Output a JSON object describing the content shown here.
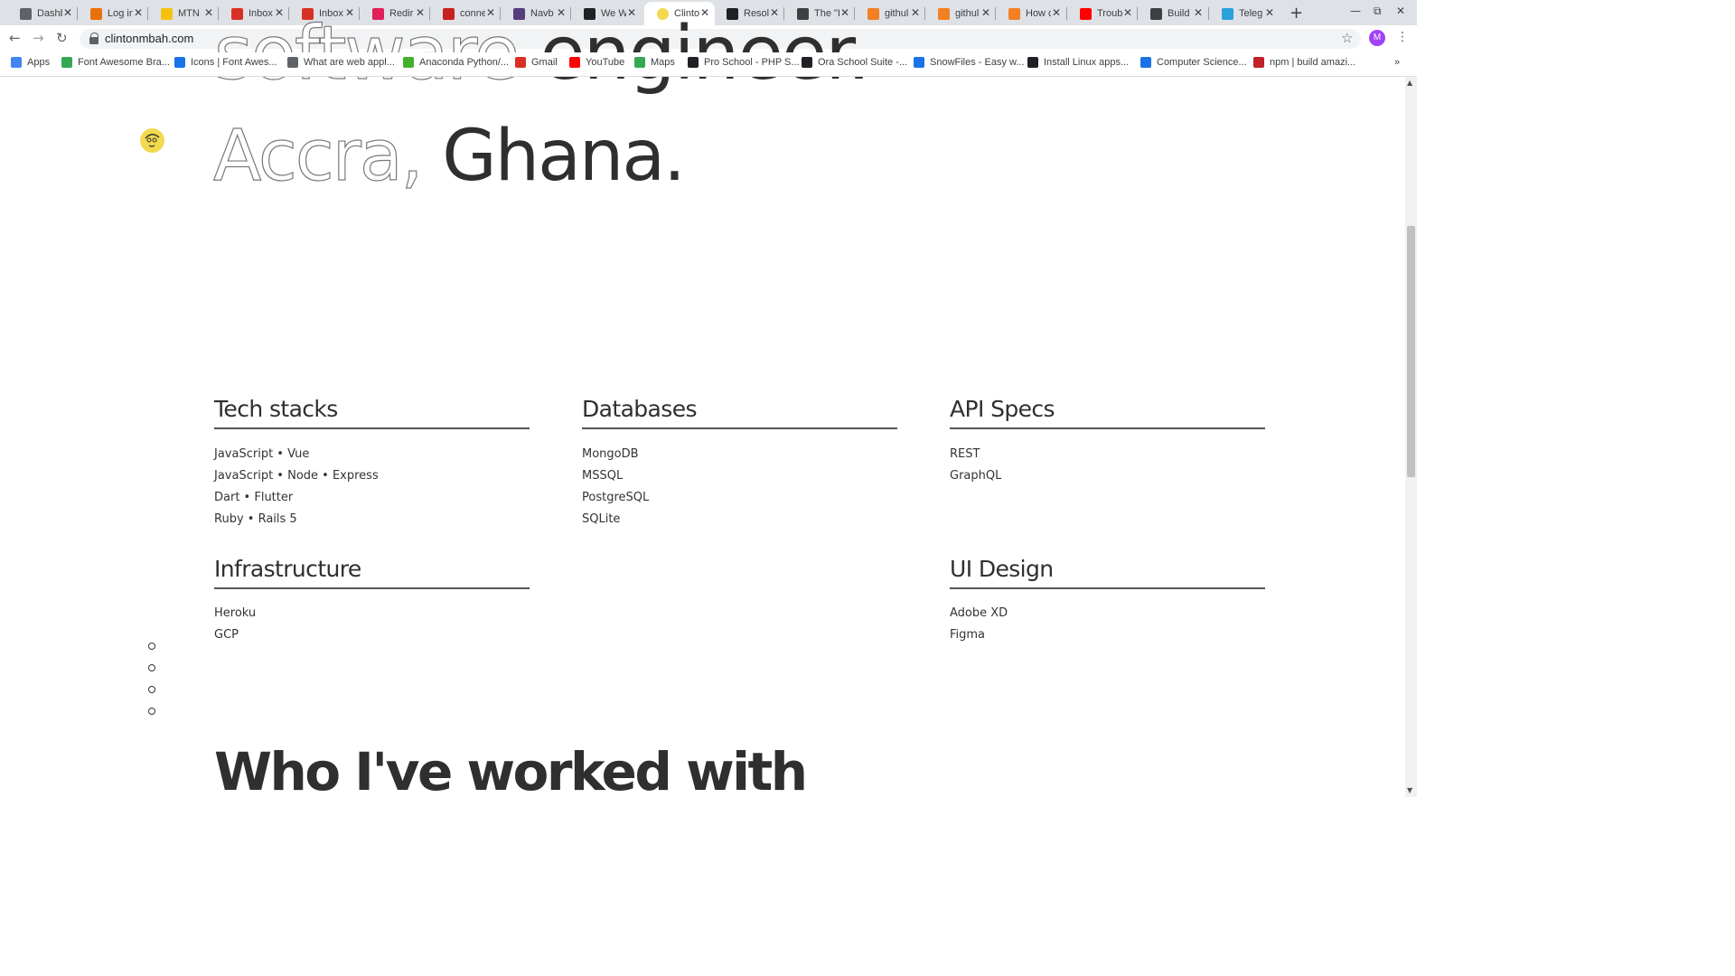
{
  "browser": {
    "tabs": [
      {
        "title": "Dashb",
        "color": "#5f6368"
      },
      {
        "title": "Log in",
        "color": "#e8710a"
      },
      {
        "title": "MTN",
        "color": "#f4c20d"
      },
      {
        "title": "Inbox",
        "color": "#d93025"
      },
      {
        "title": "Inbox",
        "color": "#d93025"
      },
      {
        "title": "Redir",
        "color": "#e01e5a"
      },
      {
        "title": "conne",
        "color": "#c5221f"
      },
      {
        "title": "Navb",
        "color": "#563d7c"
      },
      {
        "title": "We W",
        "color": "#202124"
      },
      {
        "title": "Clinto",
        "color": "#f2d94e"
      },
      {
        "title": "Resol",
        "color": "#202124"
      },
      {
        "title": "The \"I",
        "color": "#3c4043"
      },
      {
        "title": "githul",
        "color": "#f48024"
      },
      {
        "title": "githul",
        "color": "#f48024"
      },
      {
        "title": "How c",
        "color": "#f48024"
      },
      {
        "title": "Troub",
        "color": "#ff0000"
      },
      {
        "title": "Build",
        "color": "#3c4043"
      },
      {
        "title": "Teleg",
        "color": "#2aa1da"
      }
    ],
    "active_tab": 9,
    "url": "clintonmbah.com",
    "avatar_letter": "M",
    "bookmarks": [
      {
        "label": "Apps",
        "color": "#4285f4"
      },
      {
        "label": "Font Awesome Bra...",
        "color": "#34a853"
      },
      {
        "label": "Icons | Font Awes...",
        "color": "#1a73e8"
      },
      {
        "label": "What are web appl...",
        "color": "#5f6368"
      },
      {
        "label": "Anaconda Python/...",
        "color": "#43b02a"
      },
      {
        "label": "Gmail",
        "color": "#d93025"
      },
      {
        "label": "YouTube",
        "color": "#ff0000"
      },
      {
        "label": "Maps",
        "color": "#34a853"
      },
      {
        "label": "Pro School - PHP S...",
        "color": "#202124"
      },
      {
        "label": "Ora School Suite -...",
        "color": "#202124"
      },
      {
        "label": "SnowFiles - Easy w...",
        "color": "#1a73e8"
      },
      {
        "label": "Install Linux apps...",
        "color": "#202124"
      },
      {
        "label": "Computer Science...",
        "color": "#1a73e8"
      },
      {
        "label": "npm | build amazi...",
        "color": "#c12127"
      }
    ]
  },
  "hero": {
    "line1_outline": "software",
    "line1_solid": "engineer.",
    "line2_outline": "Accra,",
    "line2_solid": "Ghana."
  },
  "sections": {
    "tech": {
      "title": "Tech stacks",
      "items": [
        "JavaScript • Vue",
        "JavaScript • Node • Express",
        "Dart • Flutter",
        "Ruby • Rails 5"
      ]
    },
    "databases": {
      "title": "Databases",
      "items": [
        "MongoDB",
        "MSSQL",
        "PostgreSQL",
        "SQLite"
      ]
    },
    "api": {
      "title": "API Specs",
      "items": [
        "REST",
        "GraphQL"
      ]
    },
    "infra": {
      "title": "Infrastructure",
      "items": [
        "Heroku",
        "GCP"
      ]
    },
    "ui": {
      "title": "UI Design",
      "items": [
        "Adobe XD",
        "Figma"
      ]
    }
  },
  "worked_heading": "Who I've worked with"
}
